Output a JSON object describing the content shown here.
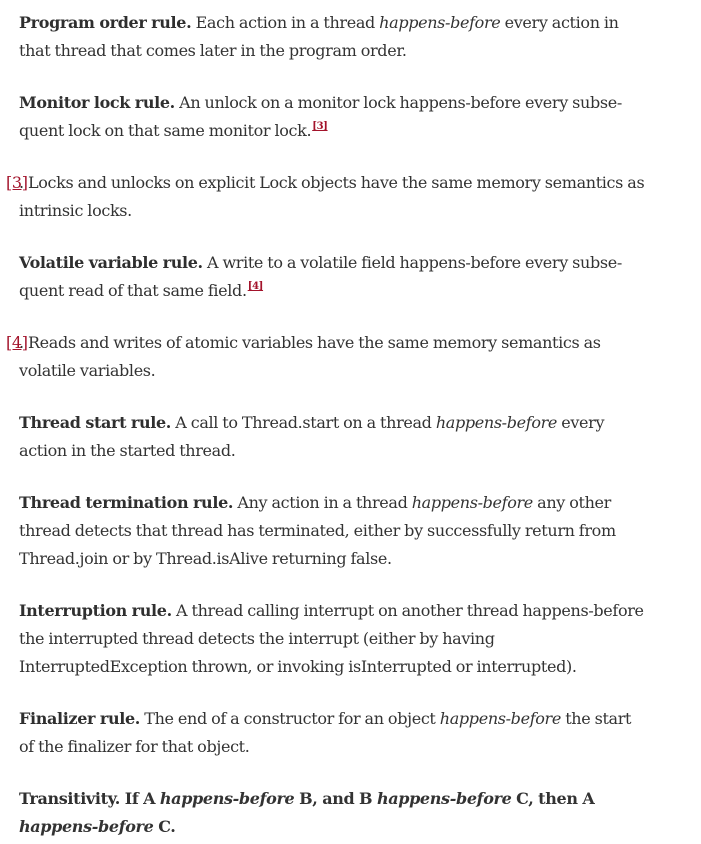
{
  "rules": [
    {
      "term": "Program order rule.",
      "parts": [
        " Each action in a thread ",
        "happens-before",
        " every action in that thread that comes later in the program order."
      ]
    },
    {
      "term": "Monitor lock rule.",
      "text": " An unlock on a monitor lock happens-before every subse-quent lock on that same monitor lock.",
      "footnote_ref": "[3]"
    },
    {
      "footnote_label": "[3]",
      "footnote_text": ". Locks and unlocks on explicit Lock objects have the same memory semantics as intrinsic locks."
    },
    {
      "term": "Volatile variable rule.",
      "text": " A write to a volatile field happens-before every subse-quent read of that same field.",
      "footnote_ref": "[4]"
    },
    {
      "footnote_label": "[4]",
      "footnote_text": ". Reads and writes of atomic variables have the same memory semantics as volatile variables."
    },
    {
      "term": "Thread start rule.",
      "parts": [
        " A call to Thread.start on a thread ",
        "happens-before",
        " every action in the started thread."
      ]
    },
    {
      "term": "Thread termination rule.",
      "parts": [
        " Any action in a thread ",
        "happens-before",
        " any other thread detects that thread has terminated, either by successfully return from Thread.join or by Thread.isAlive returning false."
      ]
    },
    {
      "term": "Interruption rule.",
      "text": " A thread calling interrupt on another thread happens-before the interrupted thread detects the interrupt (either by having InterruptedException thrown, or invoking isInterrupted or interrupted)."
    },
    {
      "term": "Finalizer rule.",
      "parts": [
        " The end of a constructor for an object ",
        "happens-before",
        " the start of the finalizer for that object."
      ]
    },
    {
      "term": "Transitivity.",
      "parts": [
        " If A ",
        "happens-before",
        " B, and B ",
        "happens-before",
        " C, then A ",
        "happens-before",
        " C."
      ]
    }
  ]
}
